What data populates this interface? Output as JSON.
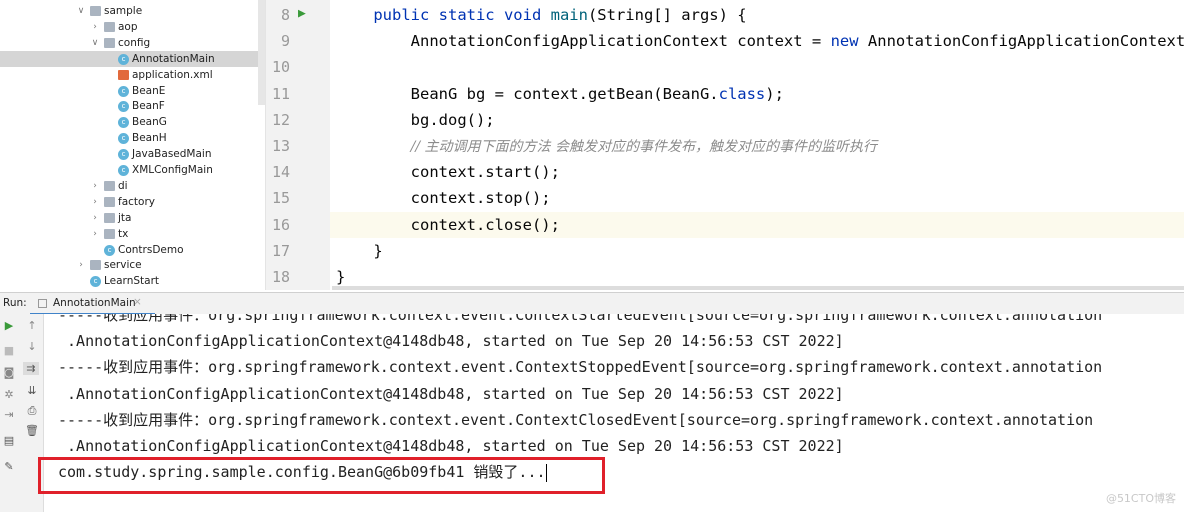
{
  "tree": [
    {
      "label": "sample",
      "type": "folder",
      "depth": 0,
      "chev": "down"
    },
    {
      "label": "aop",
      "type": "folder",
      "depth": 1,
      "chev": "right"
    },
    {
      "label": "config",
      "type": "folder",
      "depth": 1,
      "chev": "down"
    },
    {
      "label": "AnnotationMain",
      "type": "main",
      "depth": 2,
      "selected": true
    },
    {
      "label": "application.xml",
      "type": "xml",
      "depth": 2
    },
    {
      "label": "BeanE",
      "type": "class",
      "depth": 2
    },
    {
      "label": "BeanF",
      "type": "class",
      "depth": 2
    },
    {
      "label": "BeanG",
      "type": "class",
      "depth": 2
    },
    {
      "label": "BeanH",
      "type": "class",
      "depth": 2
    },
    {
      "label": "JavaBasedMain",
      "type": "main",
      "depth": 2
    },
    {
      "label": "XMLConfigMain",
      "type": "main",
      "depth": 2
    },
    {
      "label": "di",
      "type": "folder",
      "depth": 1,
      "chev": "right"
    },
    {
      "label": "factory",
      "type": "folder",
      "depth": 1,
      "chev": "right"
    },
    {
      "label": "jta",
      "type": "folder",
      "depth": 1,
      "chev": "right"
    },
    {
      "label": "tx",
      "type": "folder",
      "depth": 1,
      "chev": "right"
    },
    {
      "label": "ContrsDemo",
      "type": "class",
      "depth": 1
    },
    {
      "label": "service",
      "type": "folder",
      "depth": 0,
      "chev": "right"
    },
    {
      "label": "LearnStart",
      "type": "main",
      "depth": 0
    }
  ],
  "code": [
    {
      "n": "8",
      "parts": [
        [
          "    ",
          ""
        ],
        [
          "public static void ",
          "kw"
        ],
        [
          "main",
          "fn"
        ],
        [
          "(String[] args) {",
          ""
        ]
      ]
    },
    {
      "n": "9",
      "parts": [
        [
          "        AnnotationConfigApplicationContext context = ",
          ""
        ],
        [
          "new ",
          "kw"
        ],
        [
          "AnnotationConfigApplicationContext",
          ""
        ]
      ]
    },
    {
      "n": "10",
      "parts": []
    },
    {
      "n": "11",
      "parts": [
        [
          "        BeanG bg = context.getBean(BeanG.",
          ""
        ],
        [
          "class",
          "kw"
        ],
        [
          ");",
          ""
        ]
      ]
    },
    {
      "n": "12",
      "parts": [
        [
          "        bg.dog();",
          ""
        ]
      ]
    },
    {
      "n": "13",
      "parts": [
        [
          "        ",
          ""
        ],
        [
          "// 主动调用下面的方法 会触发对应的事件发布，触发对应的事件的监听执行",
          "cm"
        ]
      ]
    },
    {
      "n": "14",
      "parts": [
        [
          "        context.start();",
          ""
        ]
      ]
    },
    {
      "n": "15",
      "parts": [
        [
          "        context.stop();",
          ""
        ]
      ]
    },
    {
      "n": "16",
      "parts": [
        [
          "        context.close();",
          ""
        ]
      ]
    },
    {
      "n": "17",
      "parts": [
        [
          "    }",
          ""
        ]
      ]
    },
    {
      "n": "18",
      "parts": [
        [
          "}",
          ""
        ]
      ]
    }
  ],
  "run": {
    "label": "Run:",
    "tab": "AnnotationMain"
  },
  "console": [
    "-----收到应用事件：org.springframework.context.event.ContextStartedEvent[source=org.springframework.context.annotation",
    " .AnnotationConfigApplicationContext@4148db48, started on Tue Sep 20 14:56:53 CST 2022]",
    "-----收到应用事件：org.springframework.context.event.ContextStoppedEvent[source=org.springframework.context.annotation",
    " .AnnotationConfigApplicationContext@4148db48, started on Tue Sep 20 14:56:53 CST 2022]",
    "-----收到应用事件：org.springframework.context.event.ContextClosedEvent[source=org.springframework.context.annotation",
    " .AnnotationConfigApplicationContext@4148db48, started on Tue Sep 20 14:56:53 CST 2022]",
    "com.study.spring.sample.config.BeanG@6b09fb41 销毁了..."
  ],
  "highlight_color": "#e0202a",
  "watermark": "@51CTO博客"
}
